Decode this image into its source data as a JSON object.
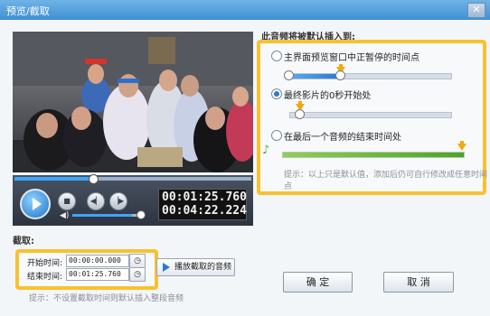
{
  "window": {
    "title": "预览/截取",
    "close_icon": "close-icon"
  },
  "player": {
    "seek_progress_fraction": 0.33,
    "volume_fraction": 0.88,
    "current_time": "00:01:25.760",
    "total_time": "00:04:22.224",
    "controls": [
      "play-icon",
      "stop-icon",
      "previous-frame-icon",
      "next-frame-icon",
      "volume-icon"
    ]
  },
  "insert": {
    "heading": "此音频将被默认插入到:",
    "options": [
      {
        "label": "主界面预览窗口中正暂停的时间点",
        "selected": false
      },
      {
        "label": "最终影片的0秒开始处",
        "selected": true
      },
      {
        "label": "在最后一个音频的结束时间处",
        "selected": false
      }
    ],
    "hint": "提示：以上只是默认值，添加后仍可自行修改成任意时间点"
  },
  "cut": {
    "heading": "截取:",
    "start_label": "开始时间:",
    "start_value": "00:00:00.000",
    "end_label": "结束时间:",
    "end_value": "00:01:25.760",
    "play_button": "播放截取的音频",
    "hint": "提示：不设置截取时间则默认插入整段音频"
  },
  "buttons": {
    "ok": "确 定",
    "cancel": "取 消"
  },
  "colors": {
    "highlight": "#f6c22f",
    "accent": "#2b79c9",
    "title_bar": "#4a97d8"
  }
}
